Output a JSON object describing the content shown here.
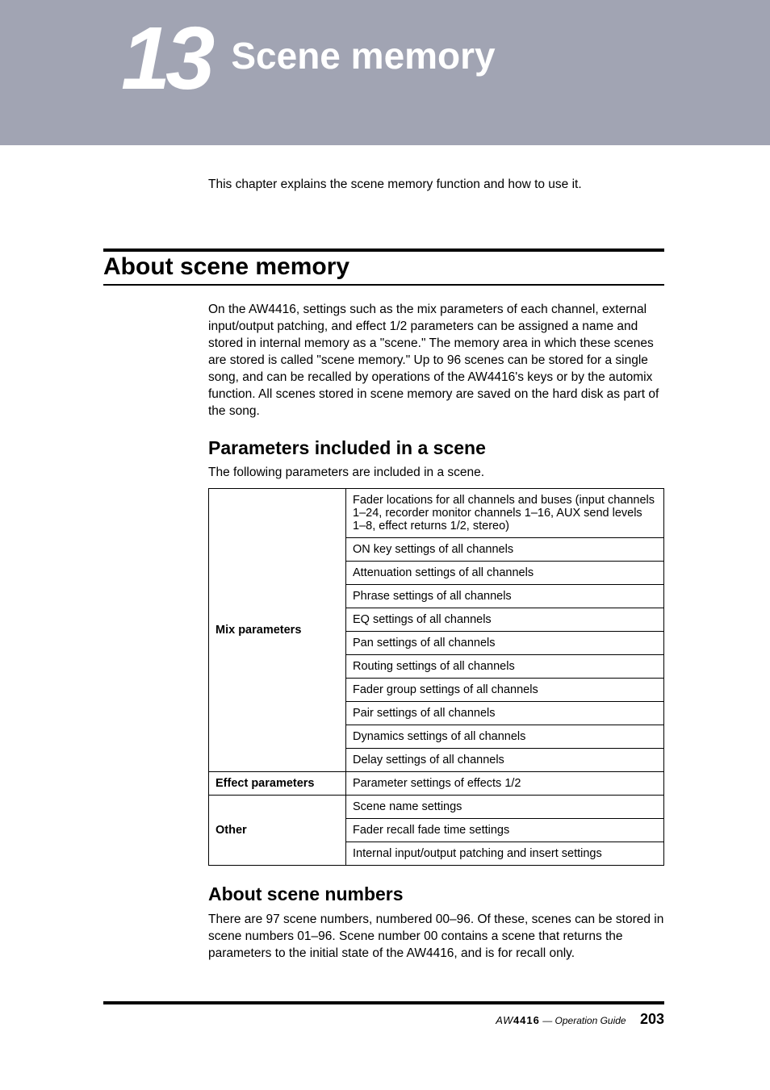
{
  "chapter": {
    "number": "13",
    "title": "Scene memory"
  },
  "intro": "This chapter explains the scene memory function and how to use it.",
  "section1": {
    "heading": "About scene memory",
    "body": "On the AW4416, settings such as the mix parameters of each channel, external input/output patching, and effect 1/2 parameters can be assigned a name and stored in internal memory as a \"scene.\" The memory area in which these scenes are stored is called \"scene memory.\" Up to 96 scenes can be stored for a single song, and can be recalled by operations of the AW4416's keys or by the automix function. All scenes stored in scene memory are saved on the hard disk as part of the song."
  },
  "params": {
    "heading": "Parameters included in a scene",
    "intro": "The following parameters are included in a scene.",
    "groups": [
      {
        "name": "Mix parameters",
        "items": [
          "Fader locations for all channels and buses (input channels 1–24, recorder monitor channels 1–16, AUX send levels 1–8, effect returns 1/2, stereo)",
          "ON key settings of all channels",
          "Attenuation settings of all channels",
          "Phrase settings of all channels",
          "EQ settings of all channels",
          "Pan settings of all channels",
          "Routing settings of all channels",
          "Fader group settings of all channels",
          "Pair settings of all channels",
          "Dynamics settings of all channels",
          "Delay settings of all channels"
        ]
      },
      {
        "name": "Effect parameters",
        "items": [
          "Parameter settings of effects 1/2"
        ]
      },
      {
        "name": "Other",
        "items": [
          "Scene name settings",
          "Fader recall fade time settings",
          "Internal input/output patching and insert settings"
        ]
      }
    ]
  },
  "scenenums": {
    "heading": "About scene numbers",
    "body": "There are 97 scene numbers, numbered 00–96. Of these, scenes can be stored in scene numbers 01–96. Scene number 00 contains a scene that returns the parameters to the initial state of the AW4416, and is for recall only."
  },
  "footer": {
    "logo_prefix": "AW",
    "logo_model": "4416",
    "guide": " — Operation Guide",
    "page": "203"
  }
}
